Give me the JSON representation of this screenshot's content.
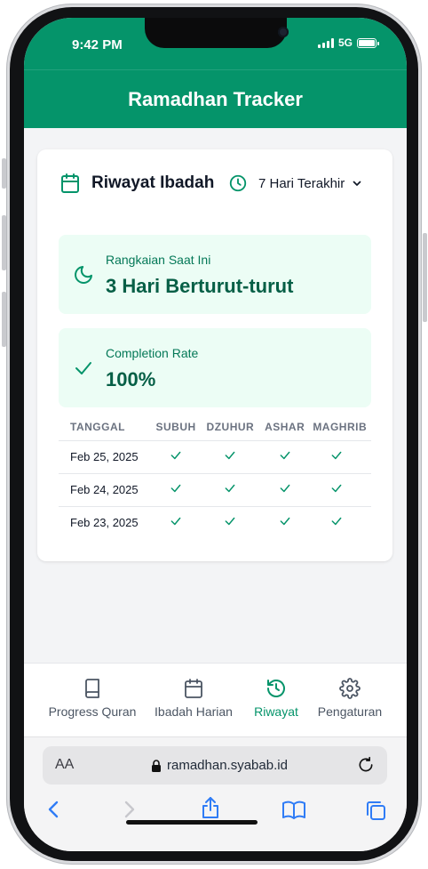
{
  "status": {
    "time": "9:42 PM",
    "network": "5G"
  },
  "app": {
    "title": "Ramadhan Tracker"
  },
  "card": {
    "title": "Riwayat Ibadah",
    "range": {
      "selected": "7 Hari Terakhir"
    },
    "streak": {
      "label": "Rangkaian Saat Ini",
      "value": "3 Hari Berturut-turut"
    },
    "completion": {
      "label": "Completion Rate",
      "value": "100%"
    }
  },
  "table": {
    "headers": [
      "TANGGAL",
      "SUBUH",
      "DZUHUR",
      "ASHAR",
      "MAGHRIB"
    ],
    "rows": [
      {
        "date": "Feb 25, 2025"
      },
      {
        "date": "Feb 24, 2025"
      },
      {
        "date": "Feb 23, 2025"
      }
    ]
  },
  "nav": {
    "items": [
      {
        "label": "Progress Quran"
      },
      {
        "label": "Ibadah Harian"
      },
      {
        "label": "Riwayat"
      },
      {
        "label": "Pengaturan"
      }
    ]
  },
  "browser": {
    "aa": "AA",
    "url": "ramadhan.syabab.id"
  },
  "colors": {
    "primary": "#05946a",
    "primaryLight": "#ecfdf5",
    "primaryDark": "#065f46"
  }
}
